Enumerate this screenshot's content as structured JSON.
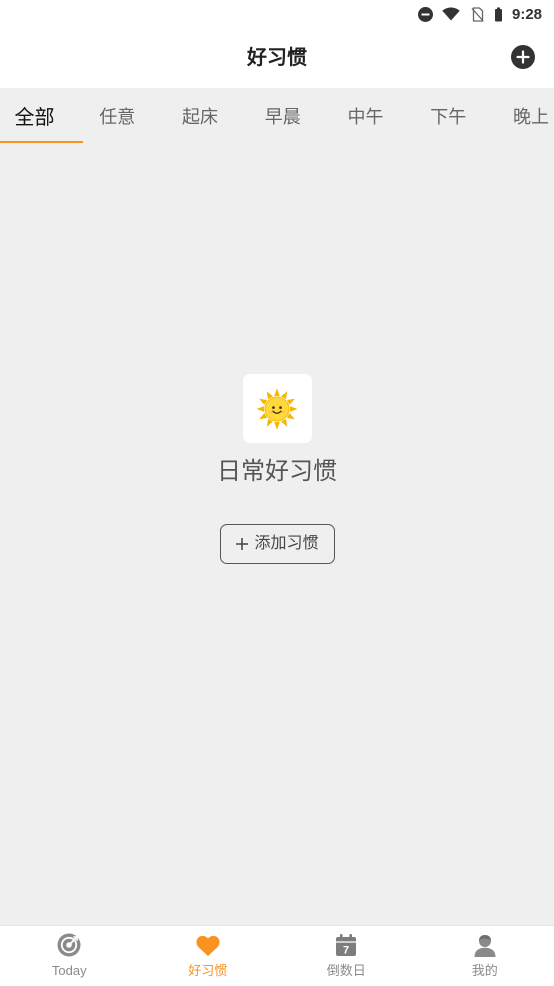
{
  "status_bar": {
    "time": "9:28",
    "icons": [
      "do-not-disturb-icon",
      "wifi-icon",
      "no-sim-icon",
      "battery-icon"
    ]
  },
  "header": {
    "title": "好习惯",
    "add_icon": "plus-circle-icon"
  },
  "tabs": [
    {
      "label": "全部",
      "selected": true
    },
    {
      "label": "任意",
      "selected": false
    },
    {
      "label": "起床",
      "selected": false
    },
    {
      "label": "早晨",
      "selected": false
    },
    {
      "label": "中午",
      "selected": false
    },
    {
      "label": "下午",
      "selected": false
    },
    {
      "label": "晚上",
      "selected": false
    }
  ],
  "empty_state": {
    "icon": "sun-icon",
    "title": "日常好习惯",
    "button_icon": "plus-icon",
    "button_label": "添加习惯"
  },
  "bottom_nav": [
    {
      "label": "Today",
      "icon": "target-icon",
      "active": false
    },
    {
      "label": "好习惯",
      "icon": "heart-icon",
      "active": true
    },
    {
      "label": "倒数日",
      "icon": "calendar-icon",
      "icon_text": "7",
      "active": false
    },
    {
      "label": "我的",
      "icon": "person-icon",
      "active": false
    }
  ],
  "colors": {
    "accent": "#f7931e",
    "background": "#efefef",
    "surface": "#ffffff",
    "text_primary": "#222222",
    "text_secondary": "#666666",
    "icon_inactive": "#8a8a8a"
  }
}
